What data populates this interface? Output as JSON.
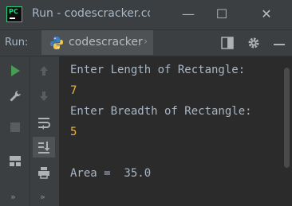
{
  "window": {
    "title": "Run - codescracker.com",
    "controls": {
      "minimize": "—",
      "maximize": "☐",
      "close": "✕"
    }
  },
  "toolbar": {
    "run_label": "Run:",
    "tab_label": "codescracker",
    "tab_chevron": "›"
  },
  "icons": [
    "app-logo",
    "python-icon",
    "layout-icon",
    "settings-icon",
    "hide-icon",
    "run-icon",
    "rerun-up-icon",
    "wrench-icon",
    "stop-icon",
    "rerun-down-icon",
    "soft-wrap-icon",
    "scroll-to-end-icon",
    "print-icon",
    "layout-toggle-icon",
    "more-icon"
  ],
  "console": {
    "lines": [
      {
        "text": "Enter Length of Rectangle:",
        "kind": "prompt"
      },
      {
        "text": "7",
        "kind": "input"
      },
      {
        "text": "Enter Breadth of Rectangle:",
        "kind": "prompt"
      },
      {
        "text": "5",
        "kind": "input"
      },
      {
        "text": "",
        "kind": "blank"
      },
      {
        "text": "Area =  35.0",
        "kind": "prompt"
      }
    ]
  },
  "gutter": {
    "more_left": "»",
    "more_right": "»"
  },
  "colors": {
    "background": "#2b2b2b",
    "panel": "#3c3f41",
    "text": "#a9b7c6",
    "input": "#eab640",
    "run_green": "#499c54"
  }
}
